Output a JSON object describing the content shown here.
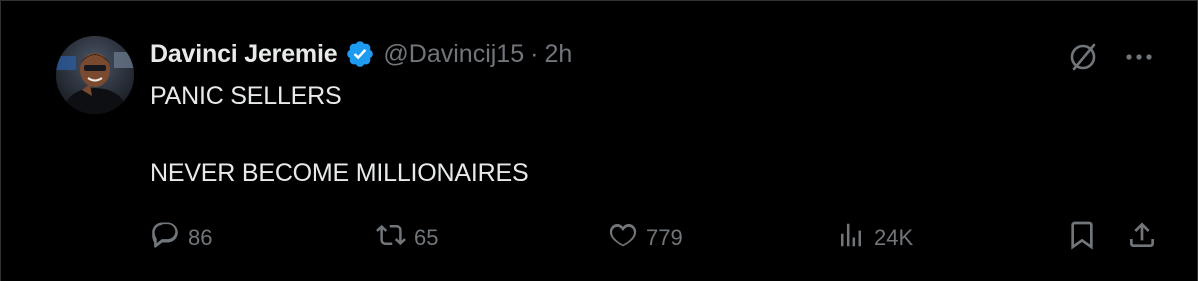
{
  "post": {
    "author": {
      "display_name": "Davinci Jeremie",
      "handle": "@Davincij15",
      "verified": true,
      "avatar_icon": "avatar-photo"
    },
    "separator": "·",
    "timestamp": "2h",
    "text_lines": [
      "PANIC SELLERS",
      "NEVER BECOME MILLIONAIRES"
    ],
    "header_icons": [
      "grok-icon",
      "more-icon"
    ],
    "stats": {
      "replies": "86",
      "reposts": "65",
      "likes": "779",
      "views": "24K"
    }
  },
  "colors": {
    "background": "#000000",
    "text_primary": "#e7e9ea",
    "text_secondary": "#71767b",
    "verified_blue": "#1d9bf0",
    "divider": "#2f3336"
  }
}
